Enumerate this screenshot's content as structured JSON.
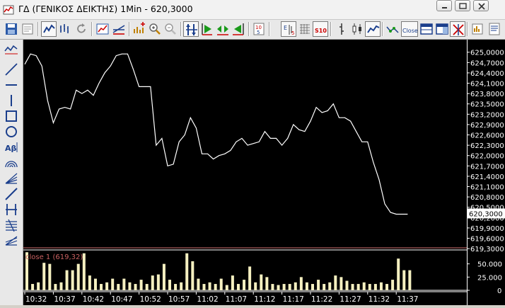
{
  "window": {
    "title": "ΓΔ (ΓΕΝΙΚΟΣ ΔΕΙΚΤΗΣ) 1Min - 620,3000"
  },
  "toolbar": {
    "icons": [
      "save-icon",
      "print-preview-icon",
      "line-chart-icon",
      "bar-chart-icon",
      "refresh-icon",
      "chart-settings-icon",
      "trendline-icon",
      "add-indicator-icon",
      "zoom-in-icon",
      "zoom-out-icon",
      "autoscale-icon",
      "play-icon",
      "step-icon",
      "back-icon",
      "indicator-list-icon",
      "bid-ask-icon",
      "grid-icon",
      "volume-icon",
      "candle-bar-icon",
      "candlestick-icon",
      "line-style-icon",
      "close-line-icon",
      "close-button",
      "window-icon",
      "panel-icon",
      "crosshair-icon",
      "export-icon",
      "report-icon"
    ],
    "close_label": "Close",
    "e_label": "E",
    "s10_label": "S10"
  },
  "left_tools": {
    "icons": [
      "chart-type-icon",
      "line-tool-icon",
      "horizontal-line-icon",
      "vertical-line-icon",
      "rectangle-icon",
      "circle-icon",
      "text-tool-icon",
      "arc-tool-icon",
      "fan-tool-icon",
      "ray-tool-icon",
      "channel-tool-icon",
      "fibonacci-icon",
      "gann-tool-icon"
    ],
    "text_tool_label": "Aβ"
  },
  "chart_data": {
    "type": "line",
    "panes": [
      {
        "name": "price",
        "y_range": [
          619.2,
          625.2
        ],
        "ticks": [
          "625,0000",
          "624,7000",
          "624,4000",
          "624,1000",
          "623,8000",
          "623,5000",
          "623,2000",
          "622,9000",
          "622,6000",
          "622,3000",
          "622,0000",
          "621,7000",
          "621,4000",
          "621,1000",
          "620,8000",
          "620,5000",
          "620,2000",
          "619,9000",
          "619,6000",
          "619,3000"
        ],
        "last_value_label": "620,3000",
        "x_minutes": [
          0,
          1,
          2,
          3,
          4,
          5,
          6,
          7,
          8,
          9,
          10,
          11,
          12,
          13,
          14,
          15,
          16,
          17,
          18,
          19,
          20,
          21,
          22,
          23,
          24,
          25,
          26,
          27,
          28,
          29,
          30,
          31,
          32,
          33,
          34,
          35,
          36,
          37,
          38,
          39,
          40,
          41,
          42,
          43,
          44,
          45,
          46,
          47,
          48,
          49,
          50,
          51,
          52,
          53,
          54,
          55,
          56,
          57,
          58,
          59,
          60,
          61,
          62,
          63,
          64,
          65,
          66,
          67
        ],
        "values": [
          624.65,
          624.95,
          624.9,
          624.6,
          623.6,
          622.95,
          623.35,
          623.4,
          623.35,
          623.9,
          623.8,
          623.9,
          623.75,
          624.1,
          624.4,
          624.6,
          624.9,
          624.95,
          624.95,
          624.5,
          624.0,
          624.0,
          624.0,
          622.3,
          622.5,
          621.7,
          621.75,
          622.4,
          622.6,
          623.1,
          622.8,
          622.05,
          622.05,
          621.9,
          622.0,
          622.05,
          622.15,
          622.4,
          622.5,
          622.3,
          622.35,
          622.4,
          622.7,
          622.5,
          622.5,
          622.3,
          622.5,
          622.9,
          622.75,
          622.7,
          623.0,
          623.4,
          623.25,
          623.3,
          623.5,
          623.1,
          623.1,
          623.0,
          622.7,
          622.4,
          622.4,
          621.8,
          621.3,
          620.6,
          620.35,
          620.3,
          620.3,
          620.3
        ]
      },
      {
        "name": "volume",
        "indicator_label": "close 1 (619,32)",
        "y_range": [
          0,
          75
        ],
        "ticks": [
          "50.000",
          "25.000",
          "0"
        ],
        "values": [
          72,
          12,
          15,
          52,
          50,
          12,
          15,
          38,
          38,
          50,
          70,
          28,
          22,
          12,
          15,
          22,
          12,
          22,
          15,
          12,
          20,
          12,
          28,
          30,
          50,
          20,
          12,
          15,
          70,
          55,
          22,
          12,
          15,
          12,
          22,
          10,
          28,
          12,
          20,
          45,
          15,
          30,
          25,
          12,
          10,
          12,
          12,
          15,
          25,
          15,
          12,
          20,
          12,
          15,
          28,
          25,
          18,
          12,
          12,
          15,
          12,
          12,
          15,
          12,
          20,
          60,
          38,
          38
        ]
      }
    ],
    "x_tick_labels": [
      "10:32",
      "10:37",
      "10:42",
      "10:47",
      "10:52",
      "10:57",
      "11:02",
      "11:07",
      "11:12",
      "11:17",
      "11:22",
      "11:27",
      "11:32",
      "11:37"
    ]
  },
  "colors": {
    "chart_background": "#000000",
    "price_line": "#ffffff",
    "volume_bars": "#f5f0c0",
    "indicator_line": "#d07070",
    "indicator_label": "#c86060",
    "axis_text": "#ffffff",
    "value_box_bg": "#ffffff",
    "value_box_text": "#000000"
  }
}
